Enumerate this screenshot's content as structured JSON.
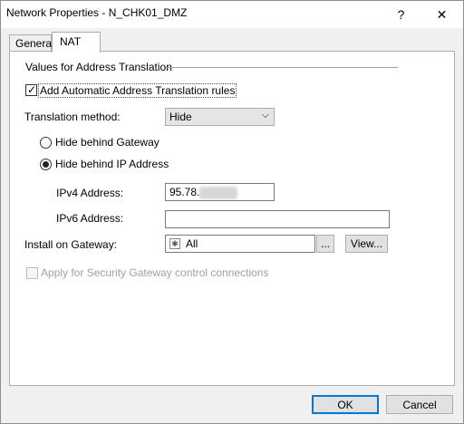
{
  "window": {
    "title": "Network Properties - N_CHK01_DMZ",
    "help_glyph": "?",
    "close_glyph": "✕"
  },
  "tabs": [
    {
      "label": "General",
      "active": false
    },
    {
      "label": "NAT",
      "active": true
    }
  ],
  "nat": {
    "group_label": "Values for Address Translation",
    "auto_rules": {
      "label": "Add Automatic Address Translation rules",
      "checked": true
    },
    "method": {
      "label": "Translation method:",
      "value": "Hide"
    },
    "hide_gateway": {
      "label": "Hide behind Gateway",
      "selected": false
    },
    "hide_ip": {
      "label": "Hide behind IP Address",
      "selected": true
    },
    "ipv4": {
      "label": "IPv4 Address:",
      "value": "95.78."
    },
    "ipv6": {
      "label": "IPv6 Address:",
      "value": ""
    },
    "install": {
      "label": "Install on Gateway:",
      "value": "All",
      "browse_label": "...",
      "view_label": "View..."
    },
    "security_gw": {
      "label": "Apply for Security Gateway control connections",
      "checked": false,
      "enabled": false
    }
  },
  "footer": {
    "ok_label": "OK",
    "cancel_label": "Cancel"
  },
  "colors": {
    "focus_border": "#0078d7",
    "disabled_text": "#a0a0a0"
  }
}
